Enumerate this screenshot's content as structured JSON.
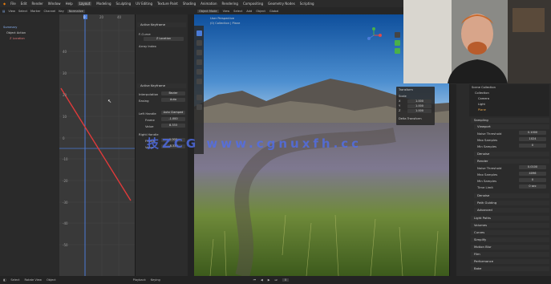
{
  "app": {
    "title": "Blender",
    "menus": [
      "File",
      "Edit",
      "Render",
      "Window",
      "Help"
    ],
    "workspace_tabs": [
      "Layout",
      "Modeling",
      "Sculpting",
      "UV Editing",
      "Texture Paint",
      "Shading",
      "Animation",
      "Rendering",
      "Compositing",
      "Geometry Nodes",
      "Scripting"
    ],
    "active_tab": "Layout"
  },
  "graph_editor": {
    "header_items": [
      "View",
      "Select",
      "Marker",
      "Channel",
      "Key",
      "Normalize"
    ],
    "frame_ticks": [
      "0",
      "20",
      "40"
    ],
    "value_ticks": [
      "40",
      "30",
      "20",
      "10",
      "0",
      "-10",
      "-20",
      "-30",
      "-40",
      "-50"
    ],
    "current_frame": "0",
    "channels": [
      "Summary",
      "Object Action",
      "Z Location"
    ],
    "curve_color": "#e03a3a"
  },
  "fcurve_panel": {
    "title": "Active Keyframe",
    "labels": [
      "F-Curve",
      "Z Location",
      "Array Index",
      "Active Keyframe",
      "Interpolation",
      "Easing",
      "Left Handle",
      "Frame",
      "Value",
      "Right Handle",
      "Frame",
      "Value"
    ],
    "values": [
      "Bezier",
      "Auto",
      "Auto Clamped",
      "-1.000",
      "8.333",
      "1.000",
      "-8.333"
    ]
  },
  "viewport": {
    "header_items": [
      "Object Mode",
      "View",
      "Select",
      "Add",
      "Object",
      "Global"
    ],
    "overlay_text": [
      "User Perspective",
      "(0) Collection | Plane"
    ],
    "n_panel": {
      "title": "Transform",
      "labels": [
        "Scale",
        "X",
        "Y",
        "Z"
      ],
      "values": [
        "1.000",
        "1.000",
        "1.000"
      ],
      "sub": "Delta Transform"
    }
  },
  "properties": {
    "sections": [
      "Sampling",
      "Viewport",
      "Noise Threshold",
      "Max Samples",
      "Min Samples",
      "Denoise",
      "Render",
      "Noise Threshold",
      "Max Samples",
      "Min Samples",
      "Time Limit",
      "Denoise",
      "Path Guiding",
      "Advanced",
      "Light Paths",
      "Volumes",
      "Curves",
      "Simplify",
      "Motion Blur",
      "Film",
      "Performance",
      "Bake"
    ],
    "values": [
      "0.1000",
      "1024",
      "0",
      "0.0100",
      "4096",
      "0",
      "0 sec"
    ],
    "outliner_items": [
      "Scene Collection",
      "Collection",
      "Camera",
      "Light",
      "Plane"
    ]
  },
  "watermark": "技ZCG www.cgnuxfh.cc",
  "statusbar": {
    "items": [
      "Select",
      "Rotate View",
      "Object"
    ],
    "frame": "0",
    "playback": "Playback",
    "keying": "Keying"
  }
}
